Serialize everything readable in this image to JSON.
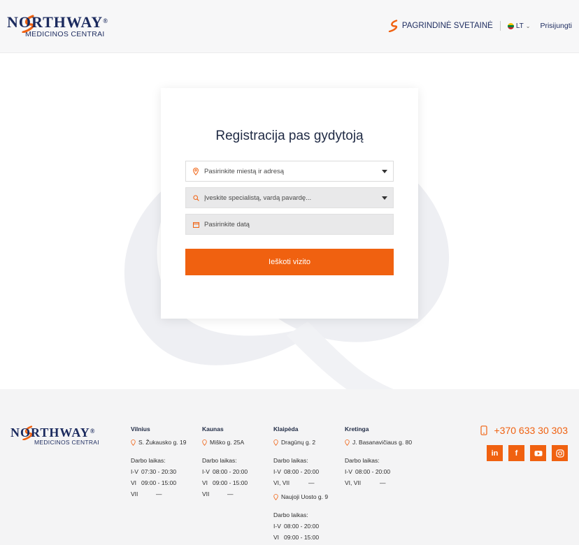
{
  "header": {
    "logo_text": "NORTHWAY",
    "logo_reg": "®",
    "logo_subtitle": "MEDICINOS CENTRAI",
    "main_site_label": "PAGRINDINĖ SVETAINĖ",
    "lang_label": "LT",
    "login_label": "Prisijungti"
  },
  "card": {
    "title": "Registracija pas gydytoją",
    "city_field_placeholder": "Pasirinkite miestą ir adresą",
    "specialist_field_placeholder": "Įveskite specialistą, vardą pavardę...",
    "date_field_placeholder": "Pasirinkite datą",
    "search_button_label": "Ieškoti vizito"
  },
  "footer": {
    "logo_text": "NORTHWAY",
    "logo_reg": "®",
    "logo_subtitle": "MEDICINOS CENTRAI",
    "hours_label": "Darbo laikas:",
    "cities": [
      {
        "name": "Vilnius",
        "address": "S. Žukausko g. 19",
        "hours": [
          {
            "days": "I-V",
            "time": "07:30 - 20:30"
          },
          {
            "days": "VI",
            "time": "09:00 - 15:00"
          },
          {
            "days": "VII",
            "time": "—"
          }
        ]
      },
      {
        "name": "Kaunas",
        "address": "Miško g. 25A",
        "hours": [
          {
            "days": "I-V",
            "time": "08:00 - 20:00"
          },
          {
            "days": "VI",
            "time": "09:00 - 15:00"
          },
          {
            "days": "VII",
            "time": "—"
          }
        ]
      },
      {
        "name": "Klaipėda",
        "address": "Dragūnų g. 2",
        "hours": [
          {
            "days": "I-V",
            "time": "08:00 - 20:00"
          },
          {
            "days": "VI, VII",
            "time": "—"
          }
        ],
        "address2": "Naujoji Uosto g. 9",
        "hours2": [
          {
            "days": "I-V",
            "time": "08:00 - 20:00"
          },
          {
            "days": "VI",
            "time": "09:00 - 15:00"
          }
        ]
      },
      {
        "name": "Kretinga",
        "address": "J. Basanavičiaus g. 80",
        "hours": [
          {
            "days": "I-V",
            "time": "08:00 - 20:00"
          },
          {
            "days": "VI, VII",
            "time": "—"
          }
        ]
      }
    ],
    "phone": "+370 633 30 303",
    "socials": [
      "linkedin-icon",
      "facebook-icon",
      "youtube-icon",
      "instagram-icon"
    ]
  },
  "colors": {
    "accent": "#f06110",
    "brand_navy": "#1b2a5e"
  }
}
